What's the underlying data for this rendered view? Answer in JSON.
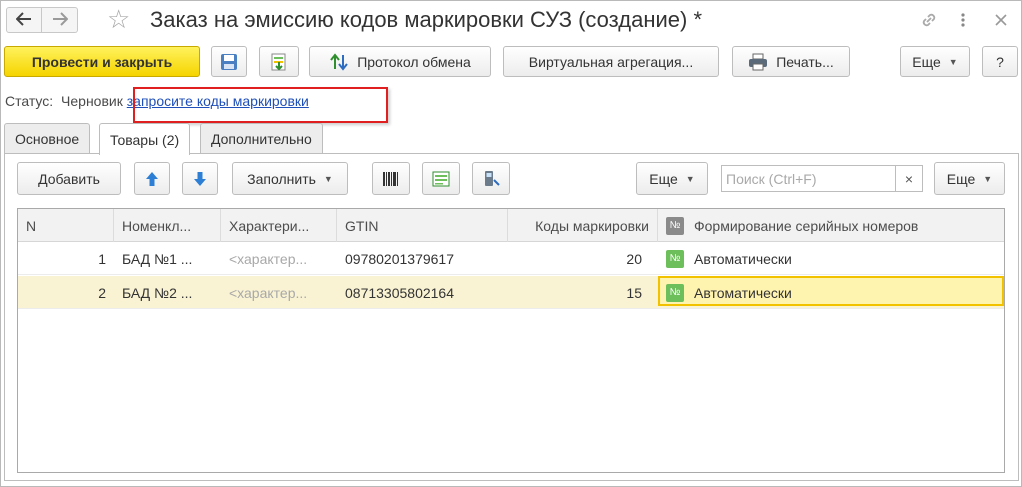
{
  "window": {
    "title": "Заказ на эмиссию кодов маркировки СУЗ (создание) *",
    "back_icon": "arrow-left-icon",
    "forward_icon": "arrow-right-icon",
    "favorite_icon": "star-icon",
    "link_icon": "link-icon",
    "more_icon": "more-vertical-icon",
    "close_icon": "close-icon"
  },
  "toolbar": {
    "post_close_label": "Провести и закрыть",
    "save_icon": "save-icon",
    "post_icon": "post-document-icon",
    "exchange_protocol_label": "Протокол обмена",
    "virtual_aggregation_label": "Виртуальная агрегация...",
    "print_label": "Печать...",
    "more_label": "Еще",
    "help_label": "?"
  },
  "status": {
    "label": "Статус:",
    "value": "Черновик",
    "link": "запросите коды маркировки"
  },
  "tabs": [
    {
      "label": "Основное",
      "active": false
    },
    {
      "label": "Товары (2)",
      "active": true
    },
    {
      "label": "Дополнительно",
      "active": false
    }
  ],
  "goods_toolbar": {
    "add_label": "Добавить",
    "up_icon": "arrow-up-icon",
    "down_icon": "arrow-down-icon",
    "fill_label": "Заполнить",
    "barcode_icon": "barcode-icon",
    "select_icon": "select-icon",
    "scanner_icon": "scanner-icon",
    "more_label": "Еще",
    "search_placeholder": "Поиск (Ctrl+F)",
    "search_clear": "×",
    "more2_label": "Еще"
  },
  "table": {
    "columns": [
      "N",
      "Номенкл...",
      "Характери...",
      "GTIN",
      "Коды маркировки",
      "Формирование серийных номеров"
    ],
    "rows": [
      {
        "n": "1",
        "item": "БАД №1 ...",
        "char": "<характер...",
        "gtin": "09780201379617",
        "codes": "20",
        "serial": "Автоматически"
      },
      {
        "n": "2",
        "item": "БАД №2 ...",
        "char": "<характер...",
        "gtin": "08713305802164",
        "codes": "15",
        "serial": "Автоматически"
      }
    ],
    "number_badge": "№"
  },
  "colors": {
    "primary_button": "#f5d400",
    "link": "#1f4fb8",
    "highlight_box": "#e02020",
    "selected_row": "#faf3d3",
    "active_cell_border": "#f2c200"
  }
}
